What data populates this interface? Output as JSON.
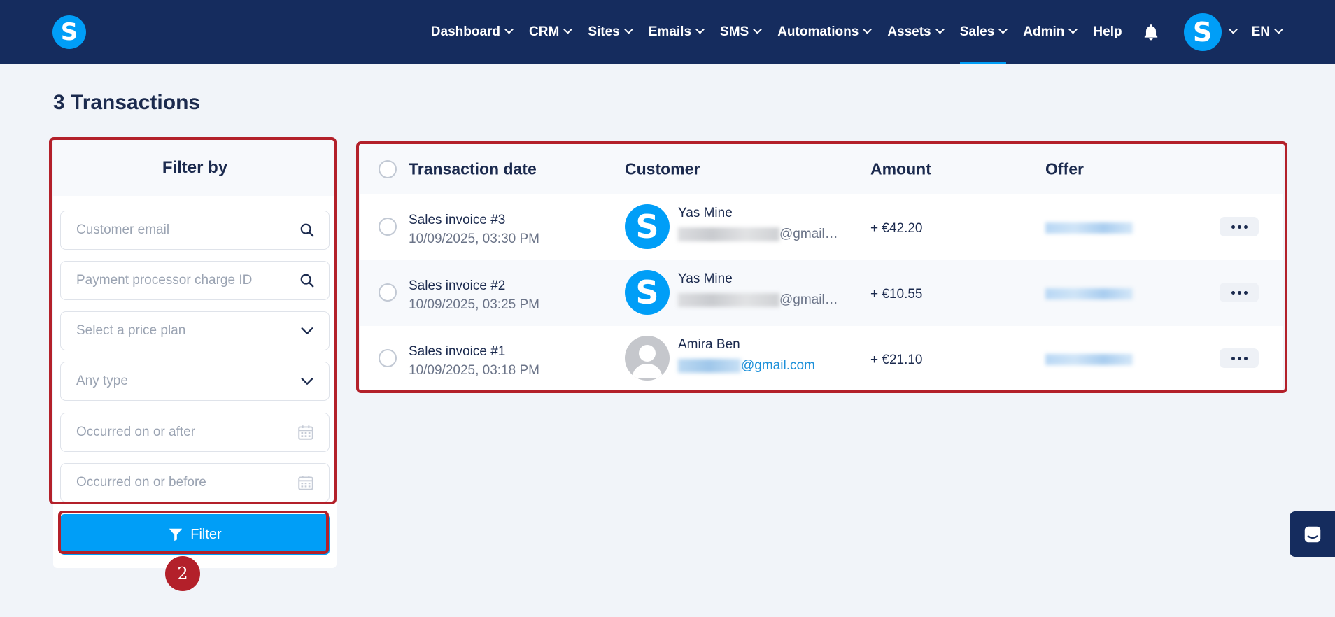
{
  "nav": {
    "logo_letter": "S",
    "items": [
      {
        "label": "Dashboard",
        "dropdown": true
      },
      {
        "label": "CRM",
        "dropdown": true
      },
      {
        "label": "Sites",
        "dropdown": true
      },
      {
        "label": "Emails",
        "dropdown": true
      },
      {
        "label": "SMS",
        "dropdown": true
      },
      {
        "label": "Automations",
        "dropdown": true
      },
      {
        "label": "Assets",
        "dropdown": true
      },
      {
        "label": "Sales",
        "dropdown": true,
        "active": true
      },
      {
        "label": "Admin",
        "dropdown": true
      },
      {
        "label": "Help",
        "dropdown": false
      }
    ],
    "avatar_letter": "S",
    "language": "EN",
    "colors": {
      "bar": "#152c5e",
      "accent": "#009ef7"
    }
  },
  "page": {
    "title": "3 Transactions"
  },
  "filter": {
    "heading": "Filter by",
    "fields": [
      {
        "placeholder": "Customer email",
        "icon": "search-icon"
      },
      {
        "placeholder": "Payment processor charge ID",
        "icon": "search-icon"
      },
      {
        "placeholder": "Select a price plan",
        "icon": "chevron-down-icon"
      },
      {
        "placeholder": "Any type",
        "icon": "chevron-down-icon"
      },
      {
        "placeholder": "Occurred on or after",
        "icon": "calendar-icon"
      },
      {
        "placeholder": "Occurred on or before",
        "icon": "calendar-icon"
      }
    ],
    "button_label": "Filter"
  },
  "step_badge": "2",
  "table": {
    "headers": {
      "date": "Transaction date",
      "customer": "Customer",
      "amount": "Amount",
      "offer": "Offer"
    },
    "rows": [
      {
        "title": "Sales invoice #3",
        "date": "10/09/2025, 03:30 PM",
        "customer_name": "Yas Mine",
        "email_suffix": "@gmail…",
        "amount": "+ €42.20",
        "avatar": "S"
      },
      {
        "title": "Sales invoice #2",
        "date": "10/09/2025, 03:25 PM",
        "customer_name": "Yas Mine",
        "email_suffix": "@gmail…",
        "amount": "+ €10.55",
        "avatar": "S"
      },
      {
        "title": "Sales invoice #1",
        "date": "10/09/2025, 03:18 PM",
        "customer_name": "Amira Ben",
        "email_suffix": "@gmail.com",
        "amount": "+ €21.10",
        "avatar": ""
      }
    ]
  }
}
